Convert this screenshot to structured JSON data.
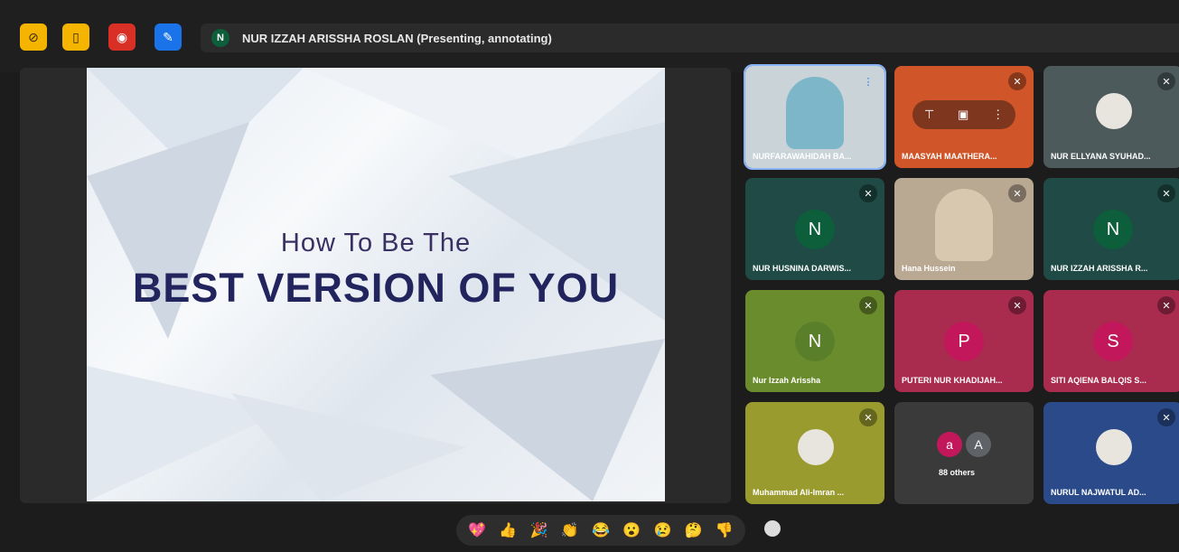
{
  "toolbar": {
    "colors": {
      "yellow": "#f4b400",
      "red": "#d93025",
      "blue": "#1a73e8"
    },
    "icons": [
      "camera-off-icon",
      "door-icon",
      "record-icon",
      "annotate-icon"
    ]
  },
  "presenter": {
    "initial": "N",
    "label": "NUR IZZAH ARISSHA ROSLAN (Presenting, annotating)"
  },
  "slide": {
    "line1": "How To Be The",
    "line2": "BEST VERSION OF YOU"
  },
  "participants": [
    {
      "name": "NURFARAWAHIDAH BA...",
      "color": "#c9d3d8",
      "kind": "video"
    },
    {
      "name": "MAASYAH MAATHERA...",
      "color": "#d0562a",
      "kind": "menu"
    },
    {
      "name": "NUR ELLYANA SYUHAD...",
      "color": "#4c5a5c",
      "kind": "photo"
    },
    {
      "name": "NUR HUSNINA DARWIS...",
      "color": "#1f4a45",
      "initial": "N",
      "letter_bg": "#0d5e3a"
    },
    {
      "name": "Hana Hussein",
      "color": "#b9a892",
      "kind": "video2"
    },
    {
      "name": "NUR IZZAH ARISSHA R...",
      "color": "#1f4a45",
      "initial": "N",
      "letter_bg": "#0d5e3a"
    },
    {
      "name": "Nur Izzah Arissha",
      "color": "#6b8c2d",
      "initial": "N",
      "letter_bg": "#5a7f2a"
    },
    {
      "name": "PUTERI NUR KHADIJAH...",
      "color": "#a92c4f",
      "initial": "P",
      "letter_bg": "#c2185b"
    },
    {
      "name": "SITI AQIENA BALQIS S...",
      "color": "#a92c4f",
      "initial": "S",
      "letter_bg": "#c2185b"
    },
    {
      "name": "Muhammad Ali-Imran ...",
      "color": "#9a9b2e",
      "kind": "photo"
    },
    {
      "name": "88 others",
      "color": "#3a3a3a",
      "kind": "others",
      "a1": "a",
      "a2": "A"
    },
    {
      "name": "NURUL NAJWATUL AD...",
      "color": "#2a4a8a",
      "kind": "photo"
    }
  ],
  "reactions": [
    "💖",
    "👍",
    "🎉",
    "👏",
    "😂",
    "😮",
    "😢",
    "🤔",
    "👎"
  ]
}
